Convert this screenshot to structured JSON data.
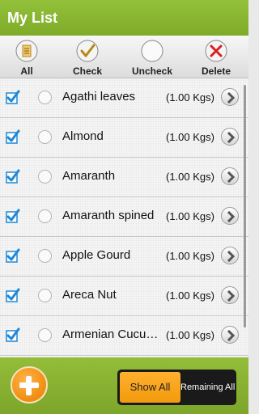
{
  "header": {
    "title": "My List"
  },
  "toolbar": {
    "all_label": "All",
    "check_label": "Check",
    "uncheck_label": "Uncheck",
    "delete_label": "Delete"
  },
  "items": [
    {
      "name": "Agathi leaves",
      "qty": "(1.00 Kgs)",
      "checked": true
    },
    {
      "name": "Almond",
      "qty": "(1.00 Kgs)",
      "checked": true
    },
    {
      "name": "Amaranth",
      "qty": "(1.00 Kgs)",
      "checked": true
    },
    {
      "name": "Amaranth spined",
      "qty": "(1.00 Kgs)",
      "checked": true
    },
    {
      "name": "Apple Gourd",
      "qty": "(1.00 Kgs)",
      "checked": true
    },
    {
      "name": "Areca Nut",
      "qty": "(1.00 Kgs)",
      "checked": true
    },
    {
      "name": "Armenian Cucu…",
      "qty": "(1.00 Kgs)",
      "checked": true
    }
  ],
  "footer": {
    "show_all_label": "Show All",
    "remaining_all_label": "Remaining All"
  },
  "colors": {
    "header_green": "#8bb733",
    "checkbox_blue": "#1e88d8",
    "accent_orange": "#f39a0d"
  },
  "icons": {
    "all": "notepad-icon",
    "check": "checkmark-icon",
    "uncheck": "empty-circle-icon",
    "delete": "red-x-icon",
    "row_arrow": "chevron-right-icon",
    "add": "plus-icon"
  }
}
